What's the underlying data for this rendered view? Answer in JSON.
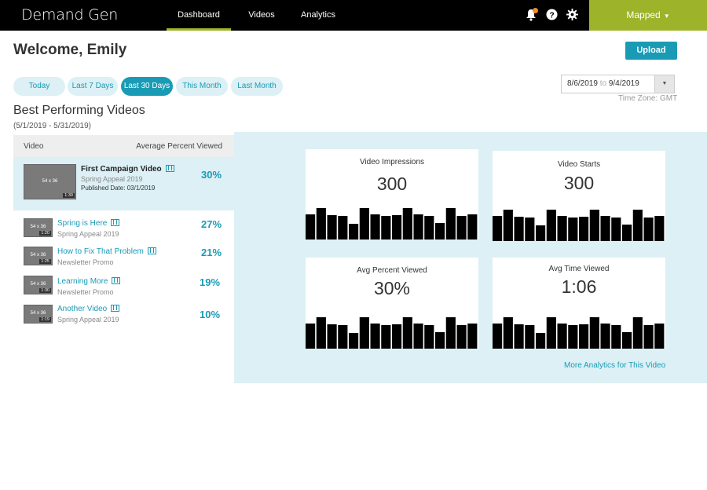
{
  "app": {
    "brand": "Demand Gen"
  },
  "nav": {
    "items": [
      {
        "label": "Dashboard",
        "active": true
      },
      {
        "label": "Videos",
        "active": false
      },
      {
        "label": "Analytics",
        "active": false
      }
    ]
  },
  "account": {
    "label": "Mapped"
  },
  "header": {
    "welcome": "Welcome, Emily",
    "upload_label": "Upload"
  },
  "filters": {
    "pills": [
      {
        "label": "Today",
        "active": false
      },
      {
        "label": "Last 7 Days",
        "active": false
      },
      {
        "label": "Last 30 Days",
        "active": true
      },
      {
        "label": "This Month",
        "active": false
      },
      {
        "label": "Last Month",
        "active": false
      }
    ],
    "date_from": "8/6/2019",
    "date_to_word": "to",
    "date_to": "9/4/2019",
    "timezone": "Time Zone: GMT"
  },
  "best": {
    "title": "Best Performing Videos",
    "range": "(5/1/2019 - 5/31/2019)",
    "col_video": "Video",
    "col_avg": "Average Percent Viewed",
    "videos": [
      {
        "title": "First Campaign Video",
        "campaign": "Spring Appeal 2019",
        "published": "Published Date: 03/1/2019",
        "percent": "30%",
        "thumb_size": "54 x 36",
        "duration": "1:30"
      },
      {
        "title": "Spring is Here",
        "campaign": "Spring Appeal 2019",
        "percent": "27%",
        "thumb_size": "54 x 36",
        "duration": "1:20"
      },
      {
        "title": "How to Fix That Problem",
        "campaign": "Newsletter Promo",
        "percent": "21%",
        "thumb_size": "54 x 36",
        "duration": "1:25"
      },
      {
        "title": "Learning More",
        "campaign": "Newsletter Promo",
        "percent": "19%",
        "thumb_size": "54 x 36",
        "duration": "1:30"
      },
      {
        "title": "Another Video",
        "campaign": "Spring Appeal 2019",
        "percent": "10%",
        "thumb_size": "54 x 36",
        "duration": "1:19"
      }
    ]
  },
  "stats": {
    "cards": [
      {
        "label": "Video Impressions",
        "value": "300"
      },
      {
        "label": "Video Starts",
        "value": "300"
      },
      {
        "label": "Avg Percent Viewed",
        "value": "30%"
      },
      {
        "label": "Avg Time Viewed",
        "value": "1:06"
      }
    ],
    "more_link": "More Analytics for This Video"
  },
  "chart_data": {
    "type": "bar",
    "values": [
      3.2,
      4,
      3.1,
      3,
      2,
      4,
      3.2,
      3,
      3.1,
      4,
      3.2,
      3,
      2.1,
      4,
      3,
      3.2
    ]
  },
  "colors": {
    "accent": "#1a9bb5",
    "brand_green": "#9db32a",
    "panel_bg": "#dcf0f5",
    "notification": "#f28c28"
  }
}
